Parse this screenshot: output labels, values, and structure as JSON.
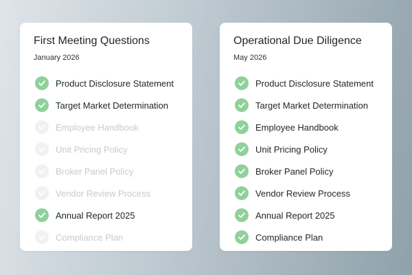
{
  "colors": {
    "check_done": "#8fd19a",
    "check_pending": "#eff1f3",
    "text_pending": "#c6cacf",
    "text_primary": "#1f2328"
  },
  "icons": {
    "item_status": "check-icon"
  },
  "cards": [
    {
      "title": "First Meeting Questions",
      "date": "January 2026",
      "items": [
        {
          "label": "Product Disclosure Statement",
          "done": true
        },
        {
          "label": "Target Market Determination",
          "done": true
        },
        {
          "label": "Employee Handbook",
          "done": false
        },
        {
          "label": "Unit Pricing Policy",
          "done": false
        },
        {
          "label": "Broker Panel Policy",
          "done": false
        },
        {
          "label": "Vendor Review Process",
          "done": false
        },
        {
          "label": "Annual Report 2025",
          "done": true
        },
        {
          "label": "Compliance Plan",
          "done": false
        }
      ]
    },
    {
      "title": "Operational Due Diligence",
      "date": "May 2026",
      "items": [
        {
          "label": "Product Disclosure Statement",
          "done": true
        },
        {
          "label": "Target Market Determination",
          "done": true
        },
        {
          "label": "Employee Handbook",
          "done": true
        },
        {
          "label": "Unit Pricing Policy",
          "done": true
        },
        {
          "label": "Broker Panel Policy",
          "done": true
        },
        {
          "label": "Vendor Review Process",
          "done": true
        },
        {
          "label": "Annual Report 2025",
          "done": true
        },
        {
          "label": "Compliance Plan",
          "done": true
        }
      ]
    }
  ]
}
